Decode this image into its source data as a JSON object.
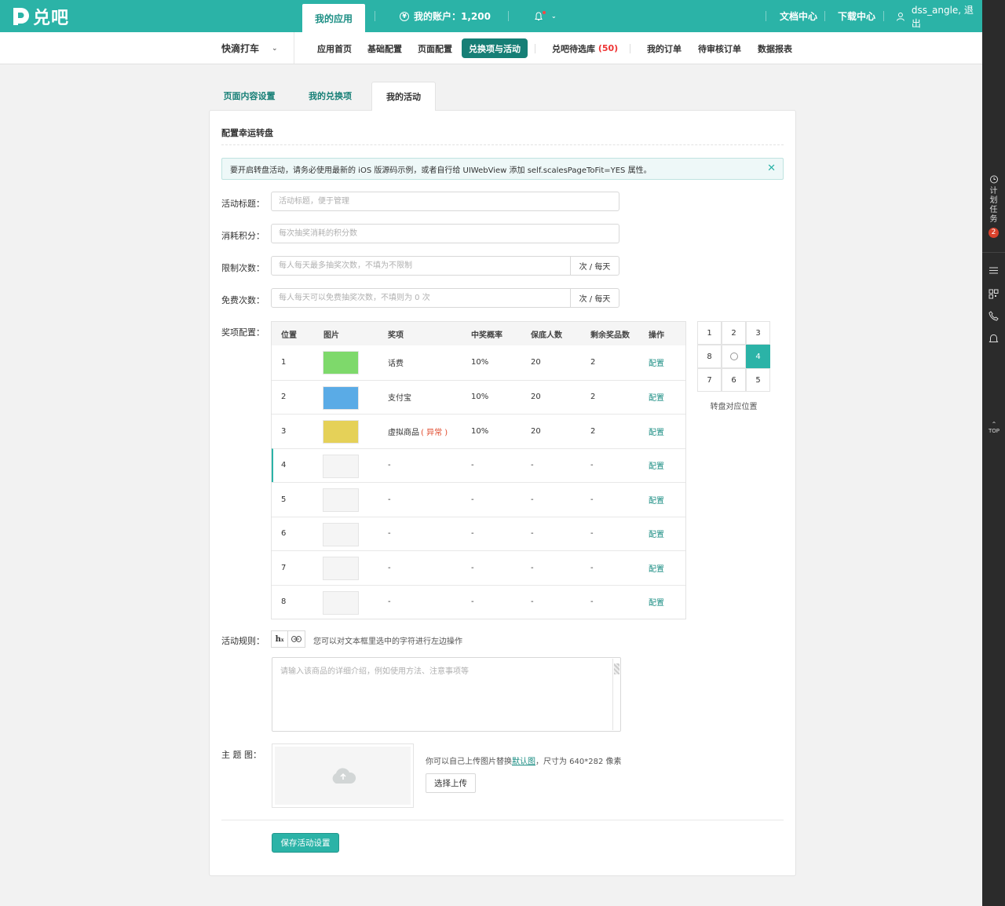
{
  "brand": {
    "name": "兑吧",
    "color": "#2bb3a7"
  },
  "topnav": {
    "my_apps": "我的应用",
    "account": "我的账户：1,200",
    "docs": "文档中心",
    "downloads": "下载中心",
    "user": "dss_angle, 退出"
  },
  "subnav": {
    "app_name": "快滴打车",
    "items": [
      {
        "label": "应用首页"
      },
      {
        "label": "基础配置"
      },
      {
        "label": "页面配置"
      },
      {
        "label": "兑换项与活动",
        "active": true
      },
      {
        "label": "兑吧待选库"
      },
      {
        "label": "我的订单"
      },
      {
        "label": "待审核订单"
      },
      {
        "label": "数据报表"
      }
    ],
    "pool_count": "(50)"
  },
  "rightbar": {
    "task_label": "计划任务",
    "task_badge": "2",
    "top_label": "TOP"
  },
  "tabs": [
    {
      "label": "页面内容设置"
    },
    {
      "label": "我的兑换项"
    },
    {
      "label": "我的活动",
      "active": true
    }
  ],
  "card": {
    "title": "配置幸运转盘",
    "alert": "要开启转盘活动，请务必使用最新的 iOS 版源码示例，或者自行给 UIWebView 添加 self.scalesPageToFit=YES 属性。"
  },
  "form": {
    "title_label": "活动标题：",
    "title_placeholder": "活动标题，便于管理",
    "cost_label": "消耗积分：",
    "cost_placeholder": "每次抽奖消耗的积分数",
    "limit_label": "限制次数：",
    "limit_placeholder": "每人每天最多抽奖次数，不填为不限制",
    "limit_unit": "次 / 每天",
    "free_label": "免费次数：",
    "free_placeholder": "每人每天可以免费抽奖次数，不填则为 0 次",
    "free_unit": "次 / 每天",
    "prizes_label": "奖项配置："
  },
  "prize_table": {
    "headers": [
      "位置",
      "图片",
      "奖项",
      "中奖概率",
      "保底人数",
      "剩余奖品数",
      "操作"
    ],
    "rows": [
      {
        "pos": "1",
        "color": "#7ed96b",
        "name": "话费",
        "note": "",
        "rate": "10%",
        "min": "20",
        "left": "2",
        "action": "配置"
      },
      {
        "pos": "2",
        "color": "#5aabe6",
        "name": "支付宝",
        "note": "",
        "rate": "10%",
        "min": "20",
        "left": "2",
        "action": "配置"
      },
      {
        "pos": "3",
        "color": "#e5d158",
        "name": "虚拟商品",
        "note": "( 异常 )",
        "rate": "10%",
        "min": "20",
        "left": "2",
        "action": "配置"
      },
      {
        "pos": "4",
        "color": "#f5f5f5",
        "name": "-",
        "note": "",
        "rate": "-",
        "min": "-",
        "left": "-",
        "action": "配置",
        "selected": true
      },
      {
        "pos": "5",
        "color": "#f5f5f5",
        "name": "-",
        "note": "",
        "rate": "-",
        "min": "-",
        "left": "-",
        "action": "配置"
      },
      {
        "pos": "6",
        "color": "#f5f5f5",
        "name": "-",
        "note": "",
        "rate": "-",
        "min": "-",
        "left": "-",
        "action": "配置"
      },
      {
        "pos": "7",
        "color": "#f5f5f5",
        "name": "-",
        "note": "",
        "rate": "-",
        "min": "-",
        "left": "-",
        "action": "配置"
      },
      {
        "pos": "8",
        "color": "#f5f5f5",
        "name": "-",
        "note": "",
        "rate": "-",
        "min": "-",
        "left": "-",
        "action": "配置"
      }
    ]
  },
  "wheel_grid": {
    "cells": [
      "1",
      "2",
      "3",
      "8",
      "",
      "4",
      "7",
      "6",
      "5"
    ],
    "selected": "4",
    "caption": "转盘对应位置"
  },
  "rules": {
    "label": "活动规则：",
    "hint": "您可以对文本框里选中的字符进行左边操作",
    "placeholder": "请输入该商品的详细介绍，例如使用方法、注意事项等"
  },
  "theme": {
    "label": "主 题 图：",
    "hint_before": "你可以自己上传图片替换",
    "hint_link": "默认图",
    "hint_after": "，尺寸为 640*282 像素",
    "upload_label": "选择上传"
  },
  "save_label": "保存活动设置"
}
